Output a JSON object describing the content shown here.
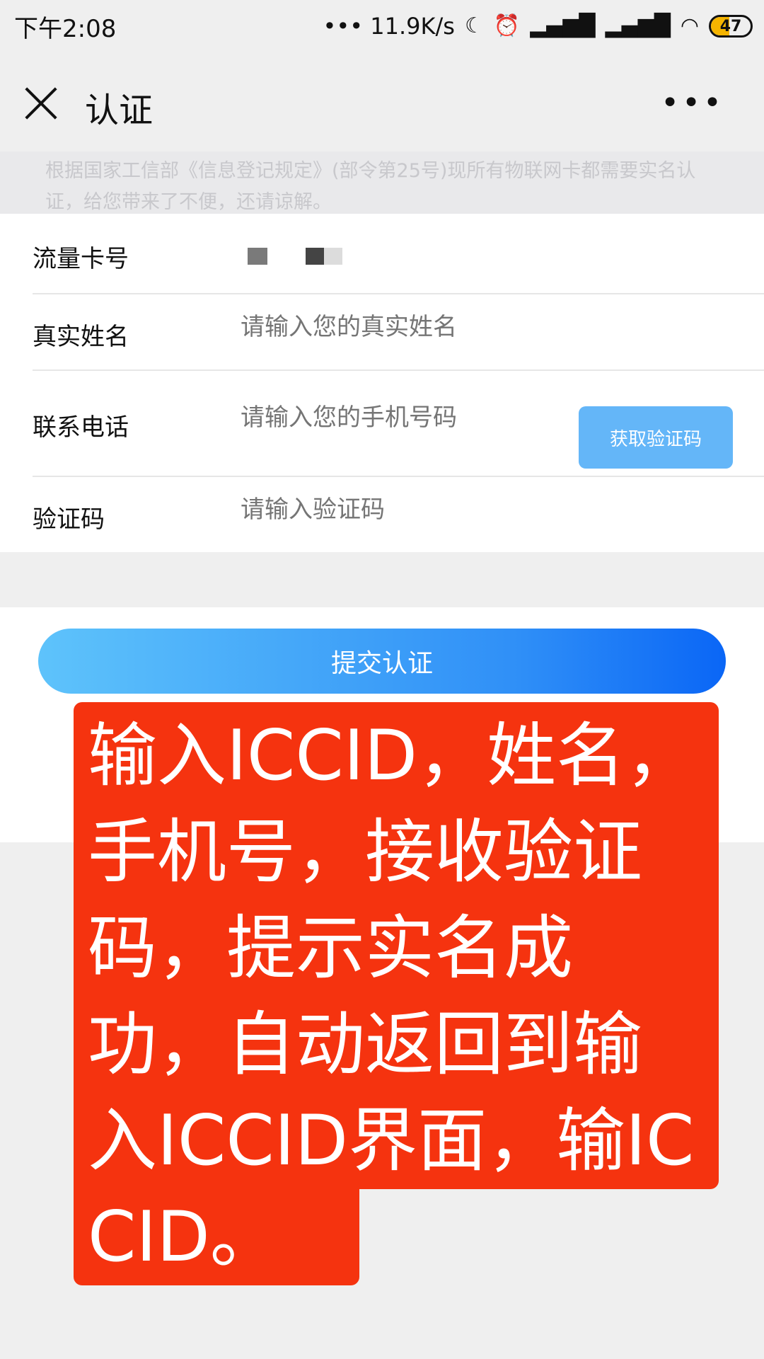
{
  "status_bar": {
    "time": "下午2:08",
    "net_speed": "••• 11.9K/s",
    "battery": "47",
    "battery_level": 0.47,
    "icons": [
      "moon-icon",
      "alarm-icon",
      "signal-icon",
      "hd-signal-icon",
      "wifi-icon",
      "battery-icon"
    ]
  },
  "header": {
    "title": "认证",
    "more": "•••"
  },
  "notice": "根据国家工信部《信息登记规定》(部令第25号)现所有物联网卡都需要实名认证，给您带来了不便，还请谅解。",
  "form": {
    "card_label": "流量卡号",
    "name_label": "真实姓名",
    "name_placeholder": "请输入您的真实姓名",
    "phone_label": "联系电话",
    "phone_placeholder": "请输入您的手机号码",
    "get_code_label": "获取验证码",
    "code_label": "验证码",
    "code_placeholder": "请输入验证码"
  },
  "submit_label": "提交认证",
  "annotation": "输入ICCID，姓名，手机号，接收验证码，提示实名成功，自动返回到输入ICCID界面，输ICCID。",
  "colors": {
    "accent_blue": "#64b6f8",
    "submit_gradient_start": "#5ec3fb",
    "submit_gradient_end": "#0a66f6",
    "annotation_red": "#f5330f"
  }
}
